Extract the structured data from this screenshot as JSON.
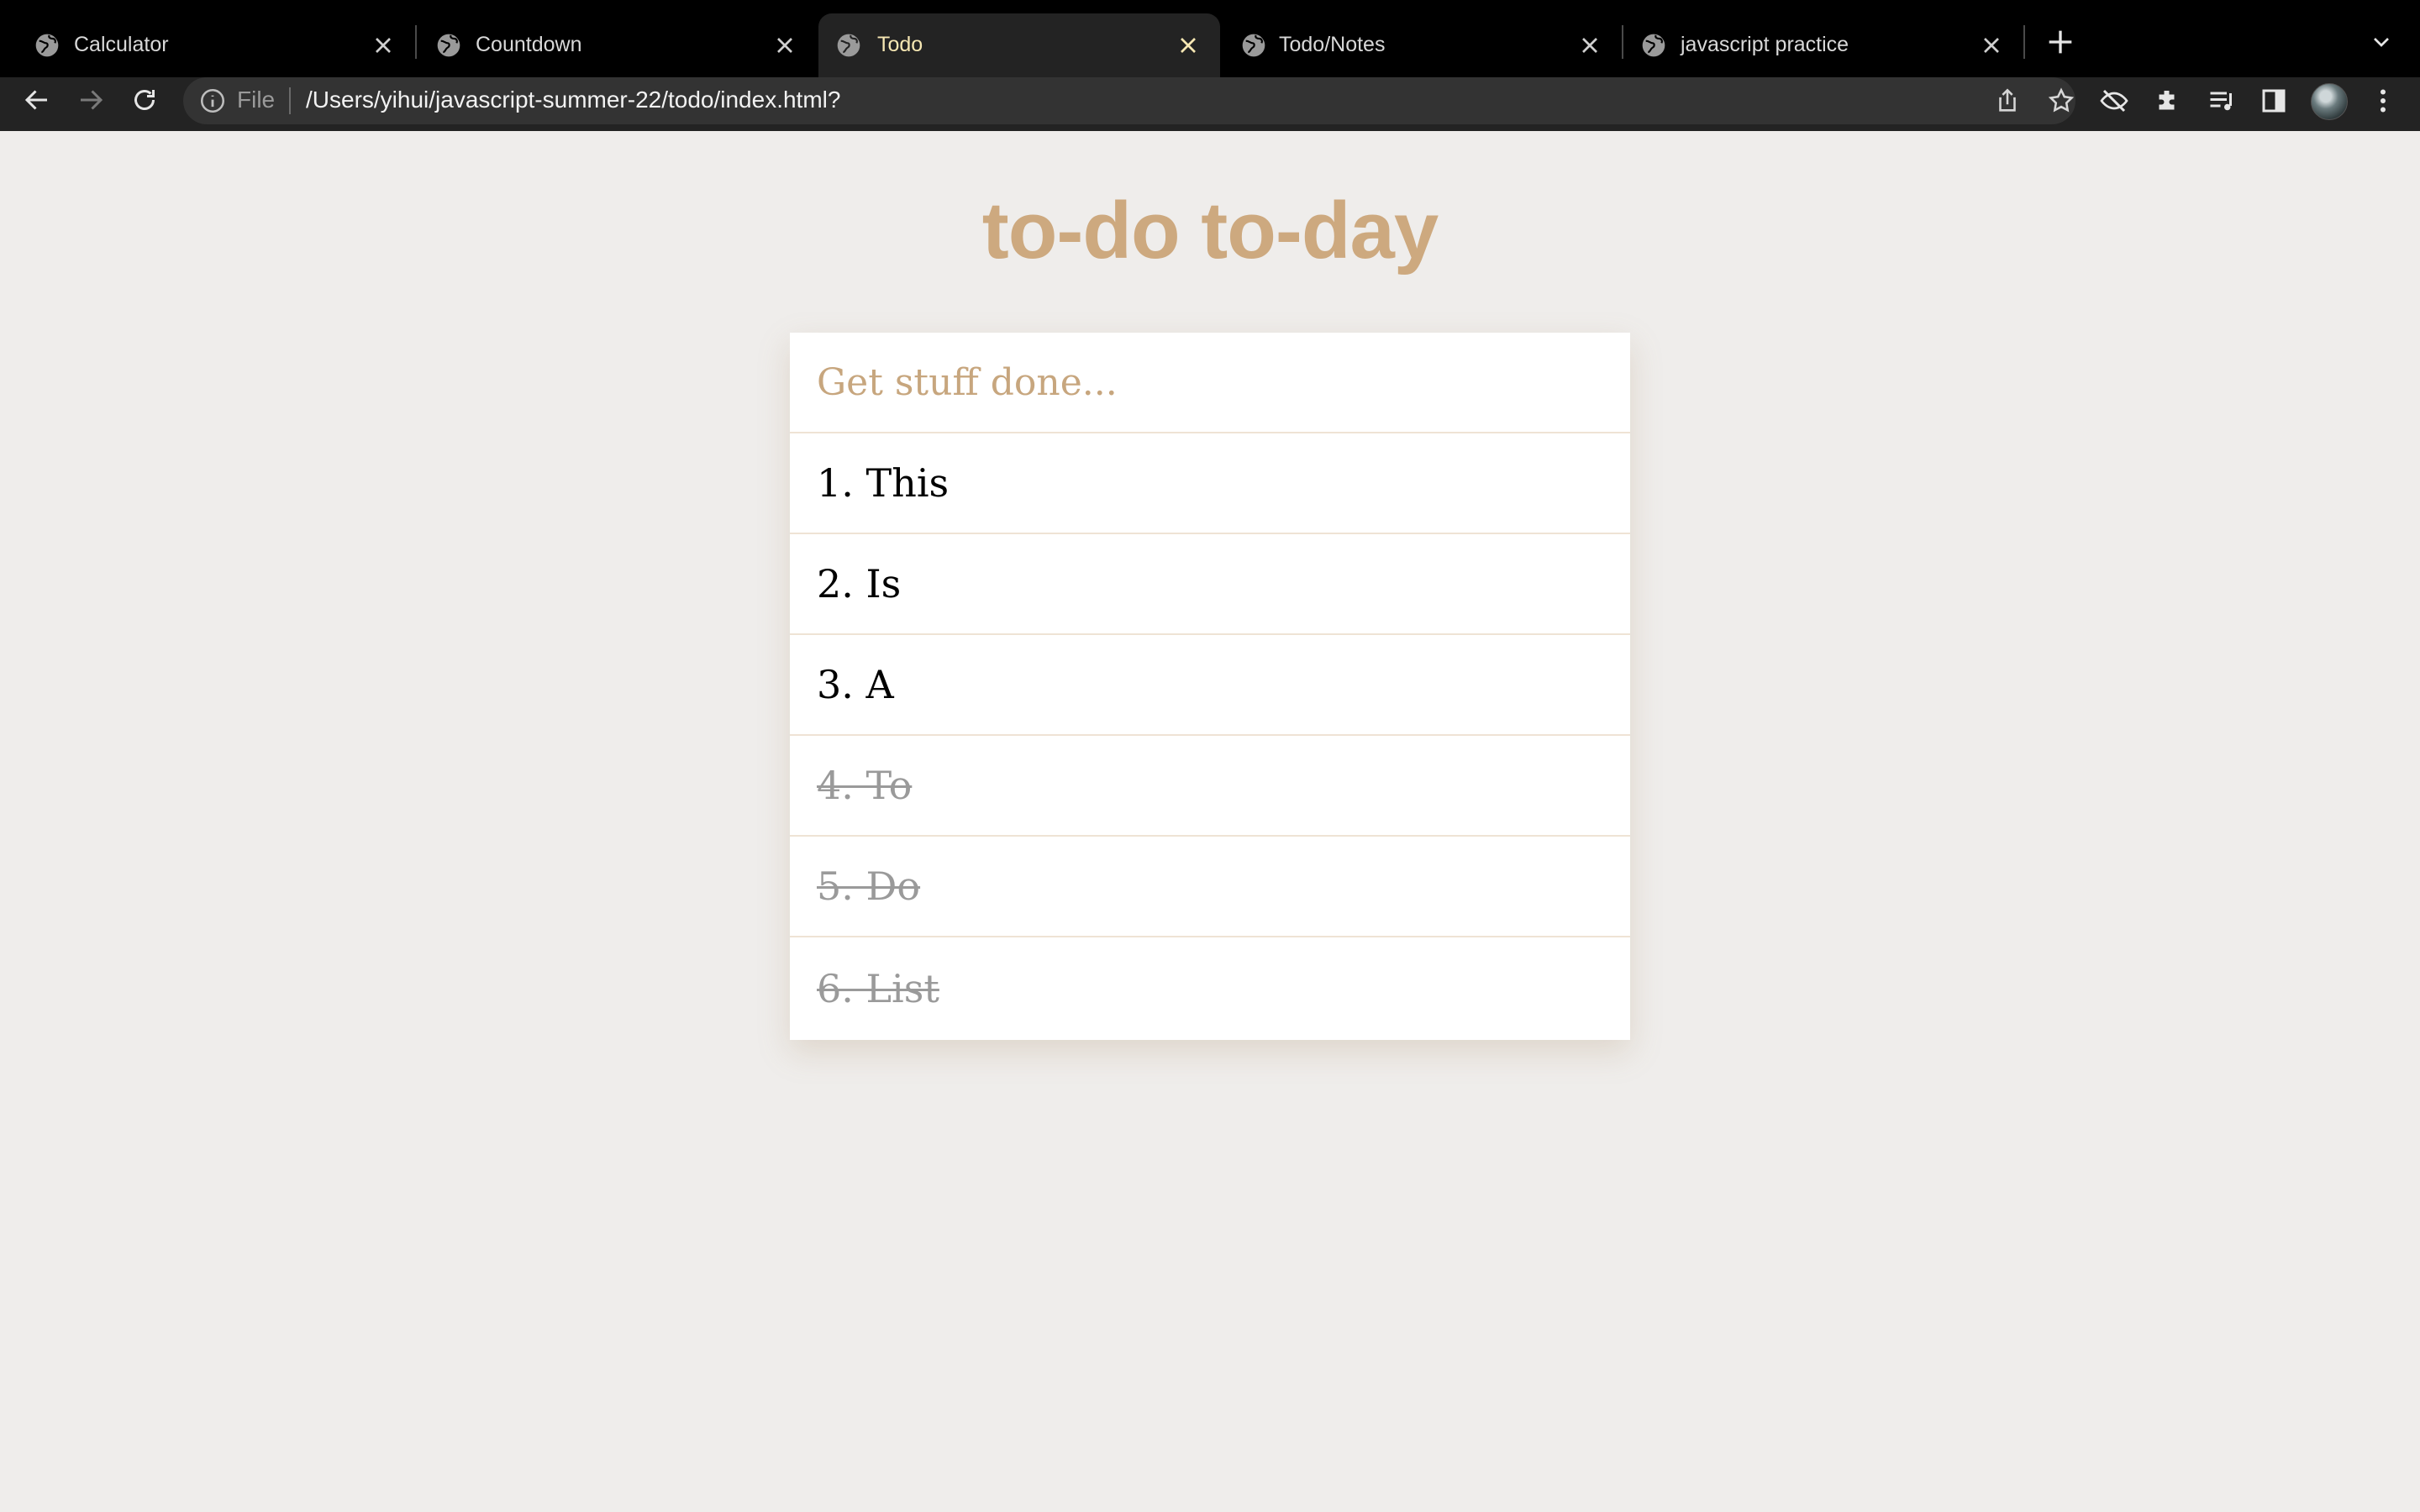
{
  "browser": {
    "tabs": [
      {
        "title": "Calculator",
        "active": false
      },
      {
        "title": "Countdown",
        "active": false
      },
      {
        "title": "Todo",
        "active": true
      },
      {
        "title": "Todo/Notes",
        "active": false
      },
      {
        "title": "javascript practice",
        "active": false
      }
    ],
    "omnibox": {
      "scheme_label": "File",
      "url": "/Users/yihui/javascript-summer-22/todo/index.html?"
    },
    "icons": {
      "back": "arrow-left-icon",
      "forward": "arrow-right-icon",
      "reload": "reload-icon",
      "info": "info-icon",
      "share": "share-icon",
      "bookmark": "star-icon",
      "eye_off": "eye-slash-icon",
      "extensions": "puzzle-icon",
      "media": "playlist-icon",
      "side_panel": "side-panel-icon",
      "menu": "kebab-menu-icon"
    },
    "colors": {
      "tab_strip": "#000000",
      "toolbar": "#232323",
      "active_tab_text": "#f6e7b3"
    }
  },
  "app": {
    "title": "to-do to-day",
    "input_placeholder": "Get stuff done...",
    "items": [
      {
        "text": "1. This",
        "done": false
      },
      {
        "text": "2. Is",
        "done": false
      },
      {
        "text": "3. A",
        "done": false
      },
      {
        "text": "4. To",
        "done": true
      },
      {
        "text": "5. Do",
        "done": true
      },
      {
        "text": "6. List",
        "done": true
      }
    ],
    "colors": {
      "accent": "#cda97f",
      "background": "#efedeb",
      "card": "#ffffff",
      "done_text": "#9a9a9a"
    }
  }
}
